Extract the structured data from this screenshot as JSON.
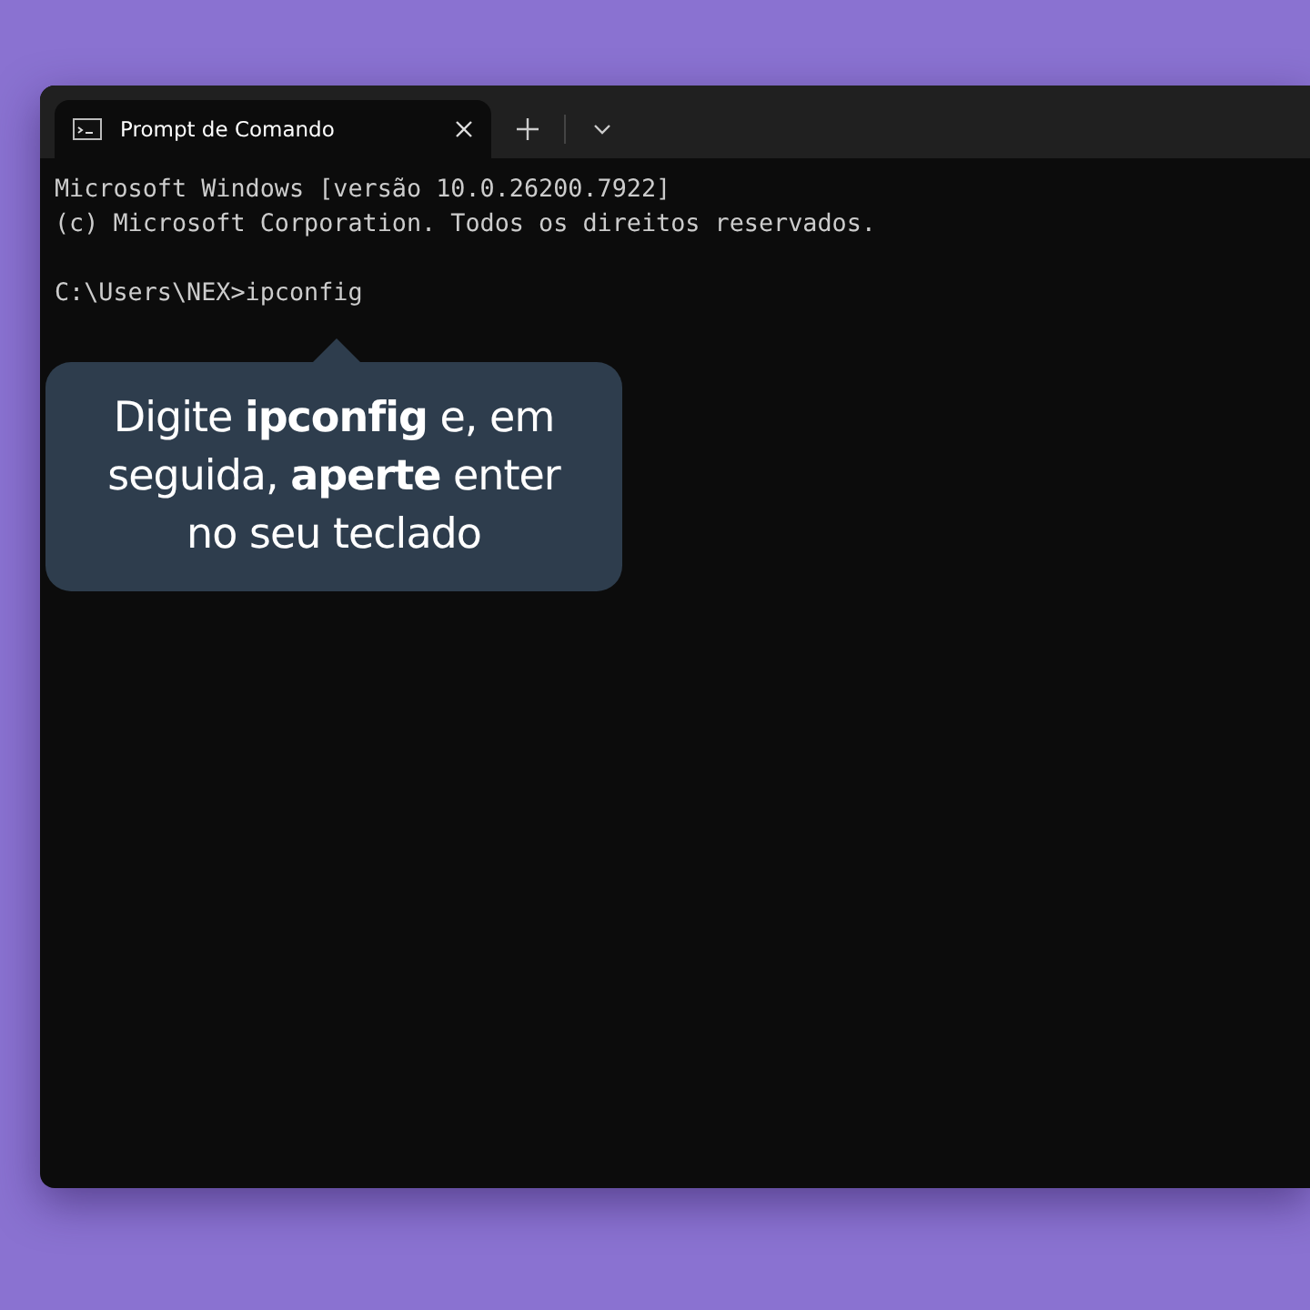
{
  "tab": {
    "title": "Prompt de Comando",
    "selected": true
  },
  "header_lines": [
    "Microsoft Windows [versão 10.0.26200.7922]",
    "(c) Microsoft Corporation. Todos os direitos reservados."
  ],
  "prompt_line": "C:\\Users\\NEX>ipconfig",
  "callout": "Digite **ipconfig** e, em seguida, **aperte** enter no seu teclado"
}
